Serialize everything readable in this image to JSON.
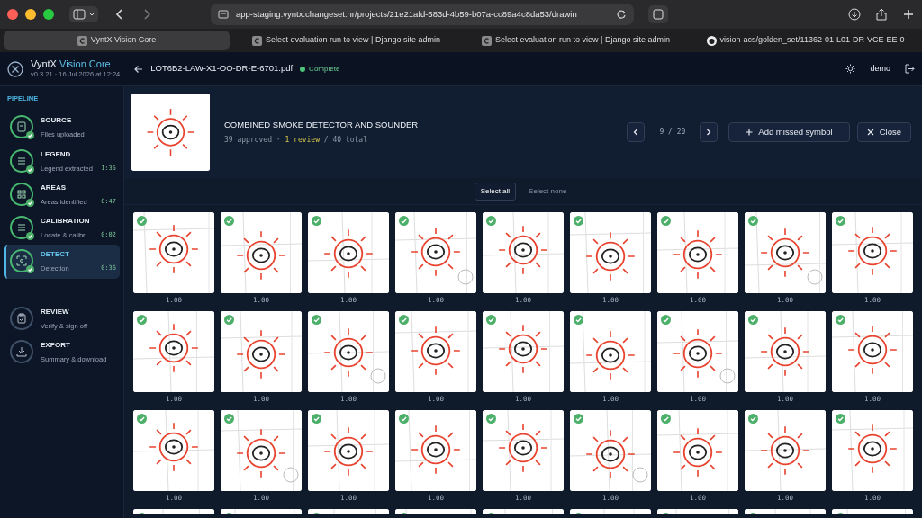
{
  "browser": {
    "url": "app-staging.vyntx.changeset.hr/projects/21e21afd-583d-4b59-b07a-cc89a4c8da53/drawin",
    "tabs": [
      {
        "label": "VyntX Vision Core",
        "selected": true,
        "kind": "app"
      },
      {
        "label": "Select evaluation run to view | Django site admin",
        "selected": false,
        "kind": "app"
      },
      {
        "label": "Select evaluation run to view | Django site admin",
        "selected": false,
        "kind": "app"
      },
      {
        "label": "vision-acs/golden_set/11362-01-L01-DR-VCE-EE-0",
        "selected": false,
        "kind": "github"
      }
    ]
  },
  "app": {
    "brand": "VyntX",
    "brand_accent": "Vision Core",
    "version": "v0.3.21 · 16 Jul 2026 at 12:24",
    "file": "LOT6B2-LAW-X1-OO-DR-E-6701.pdf",
    "status": "Complete",
    "user": "demo"
  },
  "sidebar": {
    "heading": "PIPELINE",
    "steps": [
      {
        "title": "SOURCE",
        "subtitle": "Files uploaded",
        "done": true,
        "selected": false
      },
      {
        "title": "LEGEND",
        "subtitle": "Legend extracted",
        "time": "1:35",
        "done": true,
        "selected": false
      },
      {
        "title": "AREAS",
        "subtitle": "Areas identified",
        "time": "0:47",
        "done": true,
        "selected": false
      },
      {
        "title": "CALIBRATION",
        "subtitle": "Locate & calibr...",
        "time": "0:02",
        "done": true,
        "selected": false
      },
      {
        "title": "DETECT",
        "subtitle": "Detection",
        "time": "0:36",
        "done": true,
        "selected": true
      },
      {
        "title": "REVIEW",
        "subtitle": "Verify & sign off",
        "done": false,
        "selected": false
      },
      {
        "title": "EXPORT",
        "subtitle": "Summary & download",
        "done": false,
        "selected": false
      }
    ]
  },
  "symbol": {
    "title": "COMBINED SMOKE DETECTOR AND SOUNDER",
    "approved": "39 approved",
    "separator": "·",
    "review": "1 review",
    "total": "/ 40 total",
    "pager": "9 / 20",
    "add_button": "Add missed symbol",
    "close_button": "Close"
  },
  "selection": {
    "select_all": "Select all",
    "select_none": "Select none"
  },
  "tiles": [
    {
      "approved": true,
      "score": "1.00"
    },
    {
      "approved": true,
      "score": "1.00"
    },
    {
      "approved": true,
      "score": "1.00"
    },
    {
      "approved": true,
      "score": "1.00"
    },
    {
      "approved": true,
      "score": "1.00"
    },
    {
      "approved": true,
      "score": "1.00"
    },
    {
      "approved": true,
      "score": "1.00"
    },
    {
      "approved": true,
      "score": "1.00"
    },
    {
      "approved": true,
      "score": "1.00"
    },
    {
      "approved": true,
      "score": "1.00"
    },
    {
      "approved": true,
      "score": "1.00"
    },
    {
      "approved": true,
      "score": "1.00"
    },
    {
      "approved": true,
      "score": "1.00"
    },
    {
      "approved": true,
      "score": "1.00"
    },
    {
      "approved": true,
      "score": "1.00"
    },
    {
      "approved": true,
      "score": "1.00"
    },
    {
      "approved": true,
      "score": "1.00"
    },
    {
      "approved": true,
      "score": "1.00"
    },
    {
      "approved": true,
      "score": "1.00"
    },
    {
      "approved": true,
      "score": "1.00"
    },
    {
      "approved": true,
      "score": "1.00"
    },
    {
      "approved": true,
      "score": "1.00"
    },
    {
      "approved": true,
      "score": "1.00"
    },
    {
      "approved": true,
      "score": "1.00"
    },
    {
      "approved": true,
      "score": "1.00"
    },
    {
      "approved": true,
      "score": "1.00"
    },
    {
      "approved": true,
      "score": "1.00"
    },
    {
      "approved": true
    },
    {
      "approved": true
    },
    {
      "approved": true
    },
    {
      "approved": true
    },
    {
      "approved": true
    },
    {
      "approved": true
    },
    {
      "approved": true
    },
    {
      "approved": true
    },
    {
      "approved": true
    }
  ]
}
